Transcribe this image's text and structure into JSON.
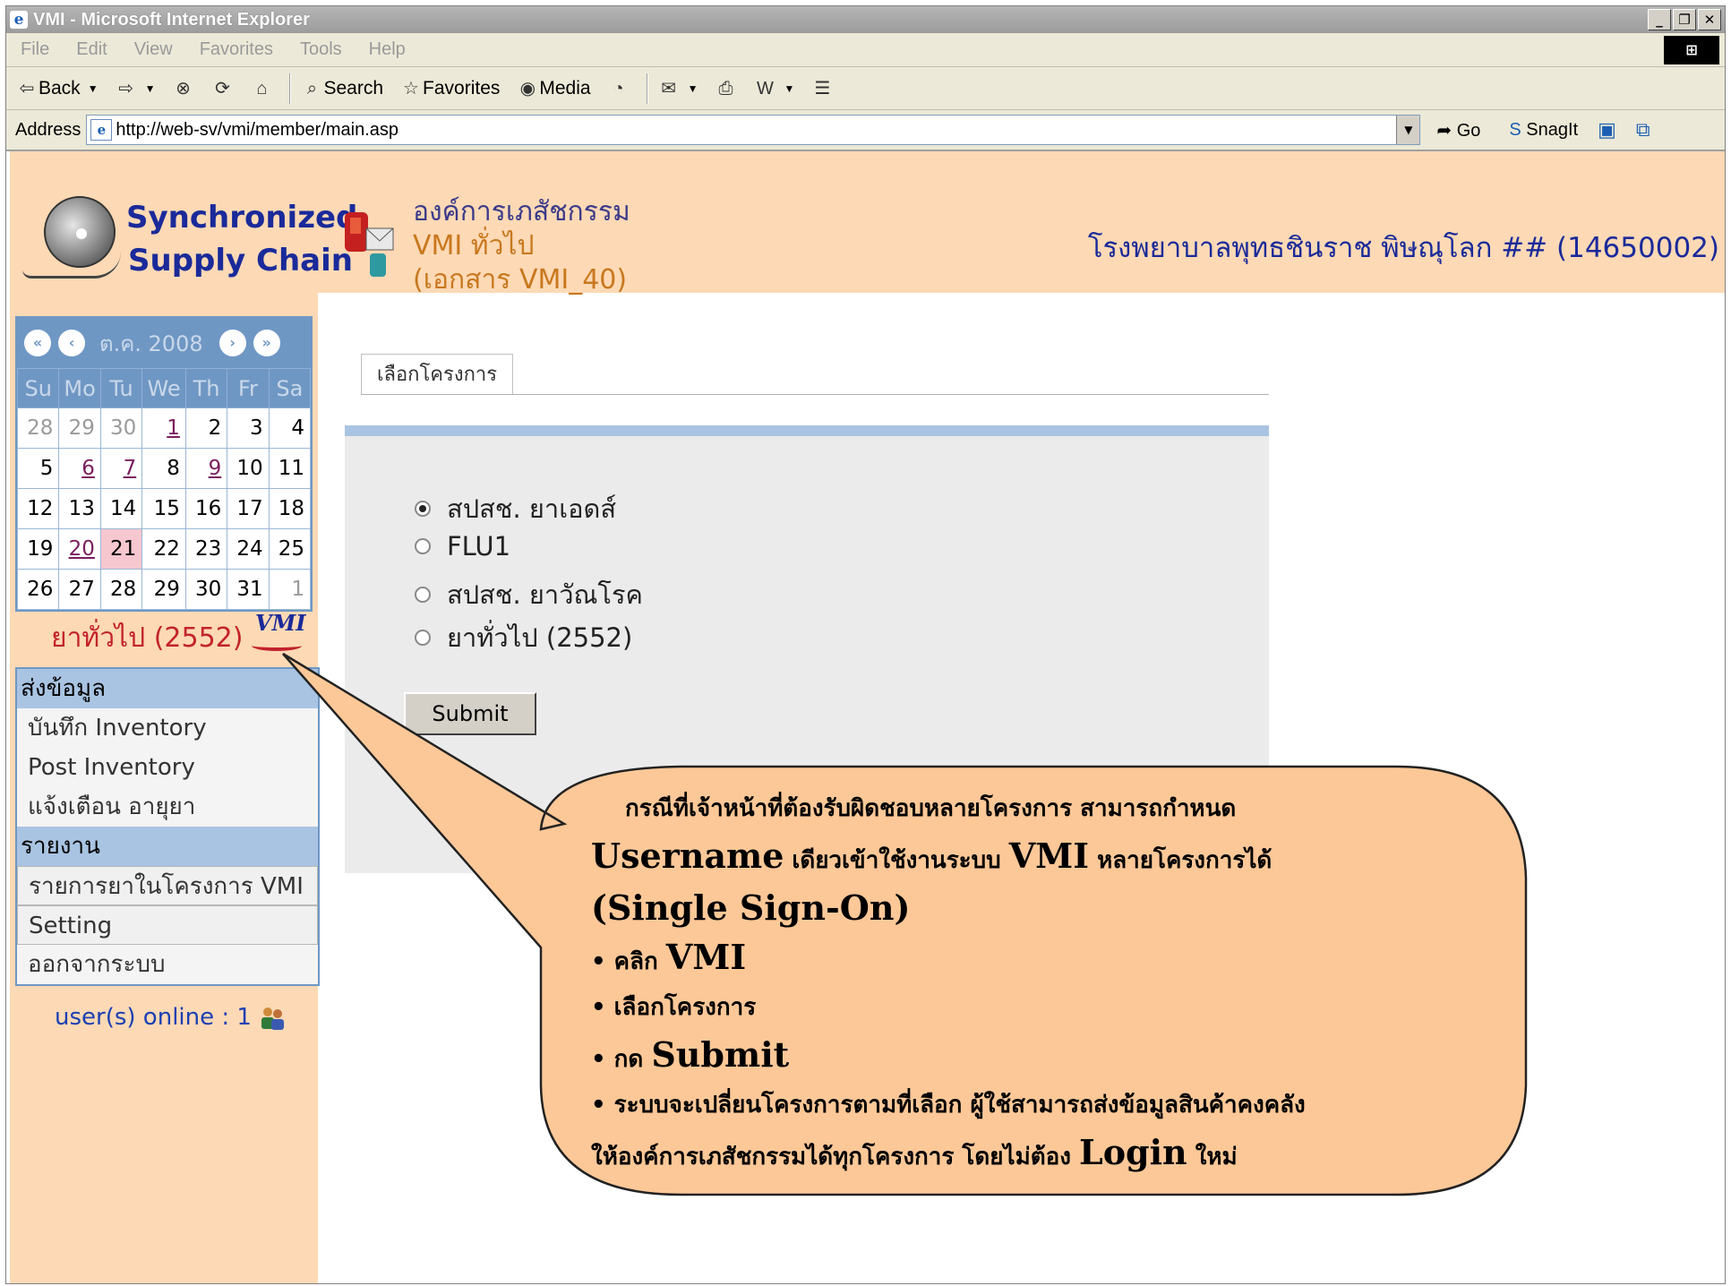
{
  "window": {
    "title": "VMI - Microsoft Internet Explorer",
    "ie_icon": "e",
    "minimize": "_",
    "restore": "❐",
    "close": "✕"
  },
  "menu": {
    "items": [
      "File",
      "Edit",
      "View",
      "Favorites",
      "Tools",
      "Help"
    ]
  },
  "toolbar": {
    "back": "Back",
    "search": "Search",
    "favorites": "Favorites",
    "media": "Media"
  },
  "address": {
    "label": "Address",
    "url": "http://web-sv/vmi/member/main.asp",
    "go": "Go",
    "snagit": "SnagIt"
  },
  "header": {
    "logo_line1": "Synchronized",
    "logo_line2": "Supply Chain",
    "org_name": "องค์การเภสัชกรรม",
    "org_sub1": "VMI ทั่วไป",
    "org_sub2": "(เอกสาร VMI_40)",
    "hospital": "โรงพยาบาลพุทธชินราช พิษณุโลก ## (14650002)"
  },
  "calendar": {
    "month_label": "ต.ค. 2008",
    "weekdays": [
      "Su",
      "Mo",
      "Tu",
      "We",
      "Th",
      "Fr",
      "Sa"
    ],
    "weeks": [
      [
        "28",
        "29",
        "30",
        "1",
        "2",
        "3",
        "4"
      ],
      [
        "5",
        "6",
        "7",
        "8",
        "9",
        "10",
        "11"
      ],
      [
        "12",
        "13",
        "14",
        "15",
        "16",
        "17",
        "18"
      ],
      [
        "19",
        "20",
        "21",
        "22",
        "23",
        "24",
        "25"
      ],
      [
        "26",
        "27",
        "28",
        "29",
        "30",
        "31",
        "1"
      ]
    ],
    "program": "ยาทั่วไป (2552)",
    "vmi_tag": "VMI"
  },
  "sidebar": {
    "send_head": "ส่งข้อมูล",
    "record_inventory": "บันทึก Inventory",
    "post_inventory": "Post Inventory",
    "expiry_alert": "แจ้งเตือน อายุยา",
    "report_head": "รายงาน",
    "vmi_drug_list": "รายการยาในโครงการ VMI",
    "setting": "Setting",
    "logout": "ออกจากระบบ",
    "online_label": "user(s) online : 1"
  },
  "main": {
    "tab_label": "เลือกโครงการ",
    "options": [
      "สปสช. ยาเอดส์",
      "FLU1",
      "สปสช. ยาวัณโรค",
      "ยาทั่วไป (2552)"
    ],
    "selected_index": 0,
    "submit_label": "Submit"
  },
  "callout": {
    "line1": "กรณีที่เจ้าหน้าที่ต้องรับผิดชอบหลายโครงการ   สามารถกำหนด",
    "line2a": "Username",
    "line2b": " เดียวเข้าใช้งานระบบ ",
    "line2c": "VMI",
    "line2d": " หลายโครงการได้",
    "line3": "(Single Sign-On)",
    "b1a": "• คลิก ",
    "b1b": "VMI",
    "b2": "• เลือกโครงการ",
    "b3a": "• กด ",
    "b3b": "Submit",
    "b4": "• ระบบจะเปลี่ยนโครงการตามที่เลือก ผู้ใช้สามารถส่งข้อมูลสินค้าคงคลัง",
    "b5a": "  ให้องค์การเภสัชกรรมได้ทุกโครงการ โดยไม่ต้อง ",
    "b5b": "Login",
    "b5c": " ใหม่",
    "fill_color": "#fdc898"
  },
  "colors": {
    "header_bg": "#fdd9b5",
    "calendar_blue": "#6f97c4",
    "menu_head": "#a9c4e2"
  }
}
